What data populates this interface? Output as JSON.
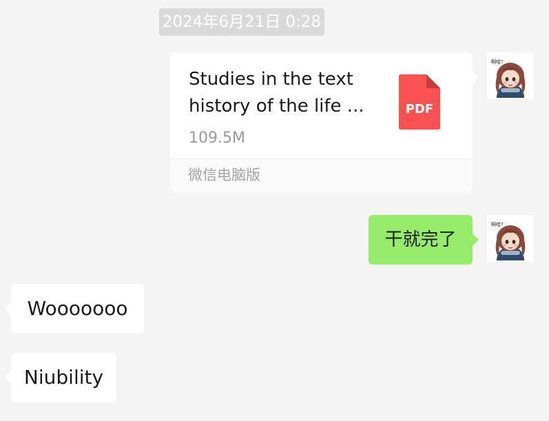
{
  "timestamp": "2024年6月21日 0:28",
  "me": {
    "avatar_caption": "啊哈?"
  },
  "file_message": {
    "title_line1": "Studies in the text",
    "title_line2": "history of the life ...",
    "size": "109.5M",
    "file_type": "PDF",
    "source": "微信电脑版",
    "icon": "pdf-file-icon",
    "icon_color": "#fa5151"
  },
  "sent_message": {
    "text": "干就完了",
    "bubble_color": "#95ec69"
  },
  "received_messages": [
    {
      "text": "Wooooooo"
    },
    {
      "text": "Niubility"
    }
  ]
}
